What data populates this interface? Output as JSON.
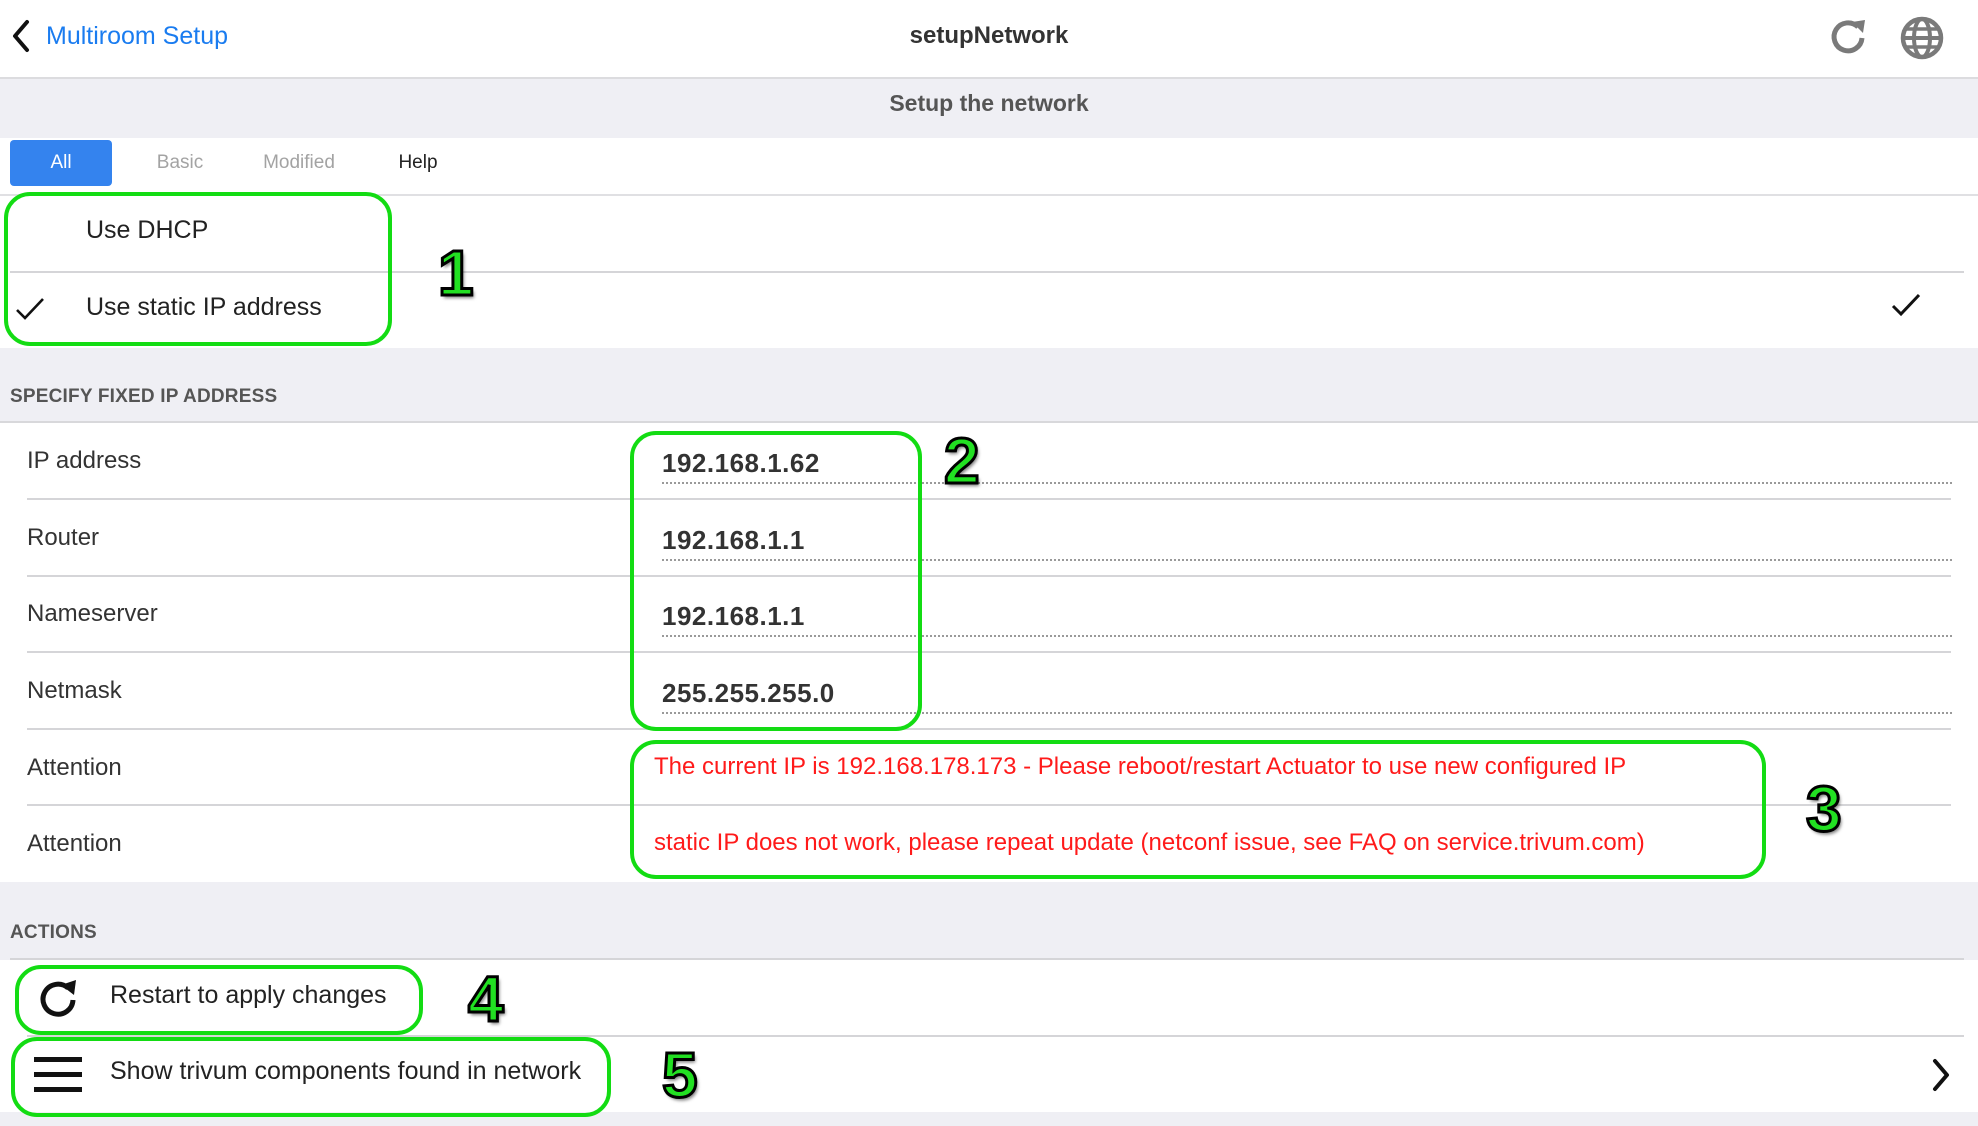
{
  "header": {
    "back_label": "Multiroom Setup",
    "title": "setupNetwork",
    "icons": {
      "back": "chevron-left-icon",
      "refresh": "refresh-icon",
      "language": "globe-icon"
    }
  },
  "subtitle": "Setup the network",
  "tabs": [
    {
      "label": "All",
      "active": true
    },
    {
      "label": "Basic",
      "active": false
    },
    {
      "label": "Modified",
      "active": false
    },
    {
      "label": "Help",
      "active": false
    }
  ],
  "mode_options": [
    {
      "label": "Use DHCP",
      "checked": false
    },
    {
      "label": "Use static IP address",
      "checked": true
    }
  ],
  "fixed_ip": {
    "section_title": "SPECIFY FIXED IP ADDRESS",
    "fields": [
      {
        "label": "IP address",
        "value": "192.168.1.62"
      },
      {
        "label": "Router",
        "value": "192.168.1.1"
      },
      {
        "label": "Nameserver",
        "value": "192.168.1.1"
      },
      {
        "label": "Netmask",
        "value": "255.255.255.0"
      }
    ],
    "attentions": [
      {
        "label": "Attention",
        "text": "The current IP is 192.168.178.173 - Please reboot/restart Actuator to use new configured IP"
      },
      {
        "label": "Attention",
        "text": "static IP does not work, please repeat update (netconf issue, see FAQ on service.trivum.com)"
      }
    ]
  },
  "actions": {
    "section_title": "ACTIONS",
    "items": [
      {
        "label": "Restart to apply changes",
        "icon": "restart-icon"
      },
      {
        "label": "Show trivum components found in network",
        "icon": "list-icon"
      }
    ]
  },
  "annotations": {
    "color": "#13dc13",
    "markers": [
      "1",
      "2",
      "3",
      "4",
      "5"
    ]
  },
  "colors": {
    "link": "#1a7cf0",
    "tab_active": "#3483ee",
    "warning": "#ff1a1a"
  }
}
